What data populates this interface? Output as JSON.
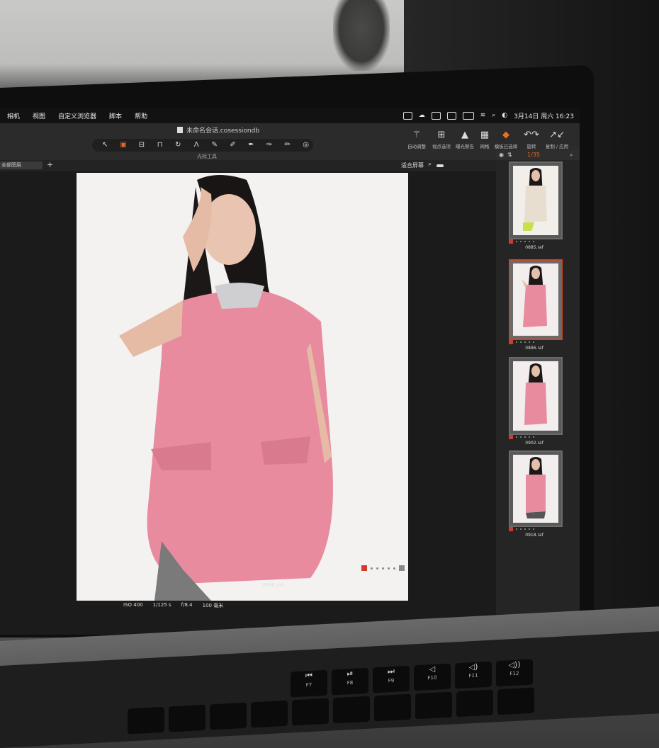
{
  "menu_bar": {
    "menus": [
      "相机",
      "视图",
      "自定义浏览器",
      "脚本",
      "帮助"
    ],
    "status_icons": [
      "cast-icon",
      "share-icon",
      "window-icon",
      "cc-icon",
      "battery-icon",
      "wifi-icon",
      "search-icon",
      "control-center-icon"
    ],
    "clock": "3月14日 周六 16:23"
  },
  "toolbar": {
    "document_title": "未命名会话.cosessiondb",
    "cursor_tools_label": "光标工具",
    "cursor_tools": [
      "select-cursor-icon",
      "crop-cursor-icon",
      "straighten-cursor-icon",
      "keystone-cursor-icon",
      "spot-removal-icon",
      "gradient-mask-icon",
      "brush-icon",
      "eraser-icon",
      "color-picker-icon",
      "annotate-icon",
      "pen-icon",
      "exposure-dial-icon"
    ],
    "right_buttons": [
      {
        "label": "自动调整",
        "icon": "magic-wand-icon"
      },
      {
        "label": "视点选项",
        "icon": "grid-view-icon"
      },
      {
        "label": "曝光警告",
        "icon": "warning-triangle-icon"
      },
      {
        "label": "网格",
        "icon": "grid-icon"
      },
      {
        "label": "模板已选择",
        "icon": "layers-icon",
        "active": true
      },
      {
        "label": "旋转",
        "icon": "rotate-icon"
      },
      {
        "label": "复制 / 应用",
        "icon": "copy-apply-icon"
      }
    ]
  },
  "subbar": {
    "layer_selector": "全部图层",
    "zoom_mode": "适合屏幕"
  },
  "viewer": {
    "filename": "0896.raf",
    "meta": [
      "ISO 400",
      "1/125 s",
      "f/8.4",
      "100 毫米"
    ]
  },
  "browser": {
    "count": "1/35",
    "thumbnails": [
      {
        "name": "0885.raf",
        "selected": false
      },
      {
        "name": "0896.raf",
        "selected": true
      },
      {
        "name": "0902.raf",
        "selected": false
      },
      {
        "name": "0918.raf",
        "selected": false
      }
    ]
  },
  "keyboard": {
    "keys": [
      {
        "glyph": "⏮",
        "label": "F7"
      },
      {
        "glyph": "⏯",
        "label": "F8"
      },
      {
        "glyph": "⏭",
        "label": "F9"
      },
      {
        "glyph": "◁",
        "label": "F10"
      },
      {
        "glyph": "◁)",
        "label": "F11"
      },
      {
        "glyph": "◁))",
        "label": "F12"
      }
    ]
  },
  "colors": {
    "accent_orange": "#e8701e",
    "selection_red": "#d2431f",
    "dress_pink": "#e98b9e"
  }
}
